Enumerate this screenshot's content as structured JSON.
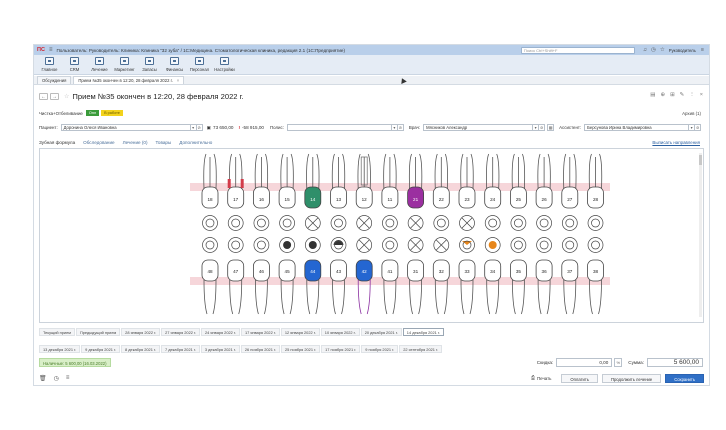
{
  "titlebar": {
    "logo": "ПС",
    "title": "Пользователь: Руководитель: Клиника: Клиника \"32 зуба\" / 1С:Медицина. Стоматологическая клиника, редакция 2.1  (1С:Предприятие)",
    "search_placeholder": "Поиск Ctrl+Shift+F",
    "user": "Руководитель"
  },
  "toolbar": [
    "Главное",
    "CRM",
    "Лечение",
    "Маркетинг",
    "Запасы",
    "Финансы",
    "Персонал",
    "Настройки"
  ],
  "tabs": [
    {
      "label": "Обсуждения"
    },
    {
      "label": "Прием №35 окончен в 12:20, 28 февраля 2022 г."
    }
  ],
  "document": {
    "title": "Прием №35 окончен в 12:20, 28 февраля 2022 г.",
    "archive": "Архив (1)"
  },
  "services": {
    "label": "Чистка+Отбеливание",
    "badge_paid": "Опл",
    "badge_pending": "В работе"
  },
  "patient_row": {
    "patient_label": "Пациент:",
    "patient": "Доронина Олеся Ивановна",
    "balance": "73 650,00",
    "debt": "-58 915,00",
    "policy_label": "Полис:",
    "policy": "",
    "doctor_label": "Врач:",
    "doctor": "Мясников Александр",
    "assistant_label": "Ассистент:",
    "assistant": "Берсунова Ирина Владимировна"
  },
  "subtabs": [
    "Зубная формула",
    "Обследование",
    "Лечение (0)",
    "Товары",
    "Дополнительно"
  ],
  "referrals_link": "Выписать направления",
  "upper_teeth": [
    "18",
    "17",
    "16",
    "15",
    "14",
    "13",
    "12",
    "11",
    "21",
    "22",
    "23",
    "24",
    "25",
    "26",
    "27",
    "28"
  ],
  "lower_teeth": [
    "48",
    "47",
    "46",
    "45",
    "44",
    "43",
    "42",
    "41",
    "31",
    "32",
    "33",
    "34",
    "35",
    "36",
    "37",
    "38"
  ],
  "colors": {
    "green": "#2f8f6a",
    "purple": "#9b2fa0",
    "blue": "#2466d1",
    "orange": "#e7861a",
    "gum": "#f2c4cb"
  },
  "dates_row1": [
    "Текущий прием",
    "Предыдущий прием",
    "28 января 2022 г.",
    "27 января 2022 г.",
    "24 января 2022 г.",
    "17 января 2022 г.",
    "12 января 2022 г.",
    "10 января 2022 г.",
    "20 декабря 2021 г.",
    "14 декабря 2021 г."
  ],
  "dates_row2": [
    "13 декабря 2021 г.",
    "9 декабря 2021 г.",
    "8 декабря 2021 г.",
    "7 декабря 2021 г.",
    "3 декабря 2021 г.",
    "26 ноября 2021 г.",
    "25 ноября 2021 г.",
    "17 ноября 2021 г.",
    "9 ноября 2021 г.",
    "22 сентября 2021 г."
  ],
  "paid_status": "Наличные: 5 600,00 (16.03.2022)",
  "totals": {
    "discount_label": "Скидка:",
    "discount": "0,00",
    "sum_label": "Сумма:",
    "sum": "5 600,00"
  },
  "buttons": {
    "print": "Печать",
    "pay": "Оплатить",
    "continue": "Продолжить лечение",
    "save": "Сохранить"
  }
}
